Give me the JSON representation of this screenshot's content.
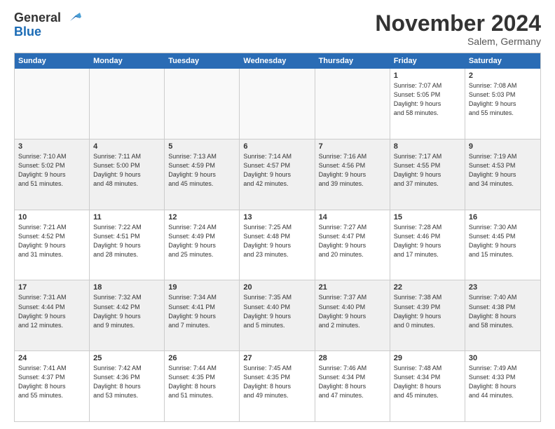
{
  "header": {
    "logo_line1": "General",
    "logo_line2": "Blue",
    "month": "November 2024",
    "location": "Salem, Germany"
  },
  "weekdays": [
    "Sunday",
    "Monday",
    "Tuesday",
    "Wednesday",
    "Thursday",
    "Friday",
    "Saturday"
  ],
  "rows": [
    [
      {
        "day": "",
        "text": "",
        "empty": true
      },
      {
        "day": "",
        "text": "",
        "empty": true
      },
      {
        "day": "",
        "text": "",
        "empty": true
      },
      {
        "day": "",
        "text": "",
        "empty": true
      },
      {
        "day": "",
        "text": "",
        "empty": true
      },
      {
        "day": "1",
        "text": "Sunrise: 7:07 AM\nSunset: 5:05 PM\nDaylight: 9 hours\nand 58 minutes."
      },
      {
        "day": "2",
        "text": "Sunrise: 7:08 AM\nSunset: 5:03 PM\nDaylight: 9 hours\nand 55 minutes."
      }
    ],
    [
      {
        "day": "3",
        "text": "Sunrise: 7:10 AM\nSunset: 5:02 PM\nDaylight: 9 hours\nand 51 minutes."
      },
      {
        "day": "4",
        "text": "Sunrise: 7:11 AM\nSunset: 5:00 PM\nDaylight: 9 hours\nand 48 minutes."
      },
      {
        "day": "5",
        "text": "Sunrise: 7:13 AM\nSunset: 4:59 PM\nDaylight: 9 hours\nand 45 minutes."
      },
      {
        "day": "6",
        "text": "Sunrise: 7:14 AM\nSunset: 4:57 PM\nDaylight: 9 hours\nand 42 minutes."
      },
      {
        "day": "7",
        "text": "Sunrise: 7:16 AM\nSunset: 4:56 PM\nDaylight: 9 hours\nand 39 minutes."
      },
      {
        "day": "8",
        "text": "Sunrise: 7:17 AM\nSunset: 4:55 PM\nDaylight: 9 hours\nand 37 minutes."
      },
      {
        "day": "9",
        "text": "Sunrise: 7:19 AM\nSunset: 4:53 PM\nDaylight: 9 hours\nand 34 minutes."
      }
    ],
    [
      {
        "day": "10",
        "text": "Sunrise: 7:21 AM\nSunset: 4:52 PM\nDaylight: 9 hours\nand 31 minutes."
      },
      {
        "day": "11",
        "text": "Sunrise: 7:22 AM\nSunset: 4:51 PM\nDaylight: 9 hours\nand 28 minutes."
      },
      {
        "day": "12",
        "text": "Sunrise: 7:24 AM\nSunset: 4:49 PM\nDaylight: 9 hours\nand 25 minutes."
      },
      {
        "day": "13",
        "text": "Sunrise: 7:25 AM\nSunset: 4:48 PM\nDaylight: 9 hours\nand 23 minutes."
      },
      {
        "day": "14",
        "text": "Sunrise: 7:27 AM\nSunset: 4:47 PM\nDaylight: 9 hours\nand 20 minutes."
      },
      {
        "day": "15",
        "text": "Sunrise: 7:28 AM\nSunset: 4:46 PM\nDaylight: 9 hours\nand 17 minutes."
      },
      {
        "day": "16",
        "text": "Sunrise: 7:30 AM\nSunset: 4:45 PM\nDaylight: 9 hours\nand 15 minutes."
      }
    ],
    [
      {
        "day": "17",
        "text": "Sunrise: 7:31 AM\nSunset: 4:44 PM\nDaylight: 9 hours\nand 12 minutes."
      },
      {
        "day": "18",
        "text": "Sunrise: 7:32 AM\nSunset: 4:42 PM\nDaylight: 9 hours\nand 9 minutes."
      },
      {
        "day": "19",
        "text": "Sunrise: 7:34 AM\nSunset: 4:41 PM\nDaylight: 9 hours\nand 7 minutes."
      },
      {
        "day": "20",
        "text": "Sunrise: 7:35 AM\nSunset: 4:40 PM\nDaylight: 9 hours\nand 5 minutes."
      },
      {
        "day": "21",
        "text": "Sunrise: 7:37 AM\nSunset: 4:40 PM\nDaylight: 9 hours\nand 2 minutes."
      },
      {
        "day": "22",
        "text": "Sunrise: 7:38 AM\nSunset: 4:39 PM\nDaylight: 9 hours\nand 0 minutes."
      },
      {
        "day": "23",
        "text": "Sunrise: 7:40 AM\nSunset: 4:38 PM\nDaylight: 8 hours\nand 58 minutes."
      }
    ],
    [
      {
        "day": "24",
        "text": "Sunrise: 7:41 AM\nSunset: 4:37 PM\nDaylight: 8 hours\nand 55 minutes."
      },
      {
        "day": "25",
        "text": "Sunrise: 7:42 AM\nSunset: 4:36 PM\nDaylight: 8 hours\nand 53 minutes."
      },
      {
        "day": "26",
        "text": "Sunrise: 7:44 AM\nSunset: 4:35 PM\nDaylight: 8 hours\nand 51 minutes."
      },
      {
        "day": "27",
        "text": "Sunrise: 7:45 AM\nSunset: 4:35 PM\nDaylight: 8 hours\nand 49 minutes."
      },
      {
        "day": "28",
        "text": "Sunrise: 7:46 AM\nSunset: 4:34 PM\nDaylight: 8 hours\nand 47 minutes."
      },
      {
        "day": "29",
        "text": "Sunrise: 7:48 AM\nSunset: 4:34 PM\nDaylight: 8 hours\nand 45 minutes."
      },
      {
        "day": "30",
        "text": "Sunrise: 7:49 AM\nSunset: 4:33 PM\nDaylight: 8 hours\nand 44 minutes."
      }
    ]
  ]
}
